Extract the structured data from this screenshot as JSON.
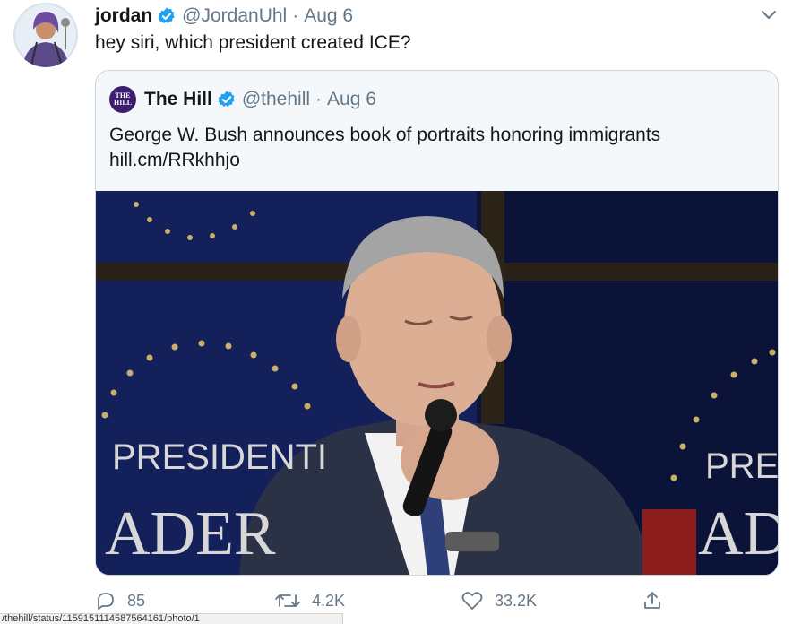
{
  "tweet": {
    "author_name": "jordan",
    "handle": "@JordanUhl",
    "separator": "·",
    "date": "Aug 6",
    "text": "hey siri, which president created ICE?"
  },
  "quoted": {
    "logo_line1": "THE",
    "logo_line2": "HILL",
    "name": "The Hill",
    "handle": "@thehill",
    "separator": "·",
    "date": "Aug 6",
    "text": "George W. Bush announces book of portraits honoring immigrants",
    "link": "hill.cm/RRkhhjo",
    "media": {
      "left_sign": "PRESIDENTI",
      "left_sign_row2": "ADER",
      "right_sign": "PRES",
      "right_sign_row2": "AD"
    }
  },
  "actions": {
    "replies": "85",
    "retweets": "4.2K",
    "likes": "33.2K"
  },
  "status_bar": {
    "url": "/thehill/status/1159151114587564161/photo/1"
  },
  "colors": {
    "text": "#14171a",
    "muted": "#657786",
    "verified": "#1da1f2",
    "border": "#ccd6dd",
    "hill_purple": "#3b1f6e"
  },
  "icons": {
    "verified": "verified-badge-icon",
    "caret": "chevron-down-icon",
    "reply": "reply-icon",
    "retweet": "retweet-icon",
    "like": "heart-icon",
    "share": "share-icon"
  }
}
